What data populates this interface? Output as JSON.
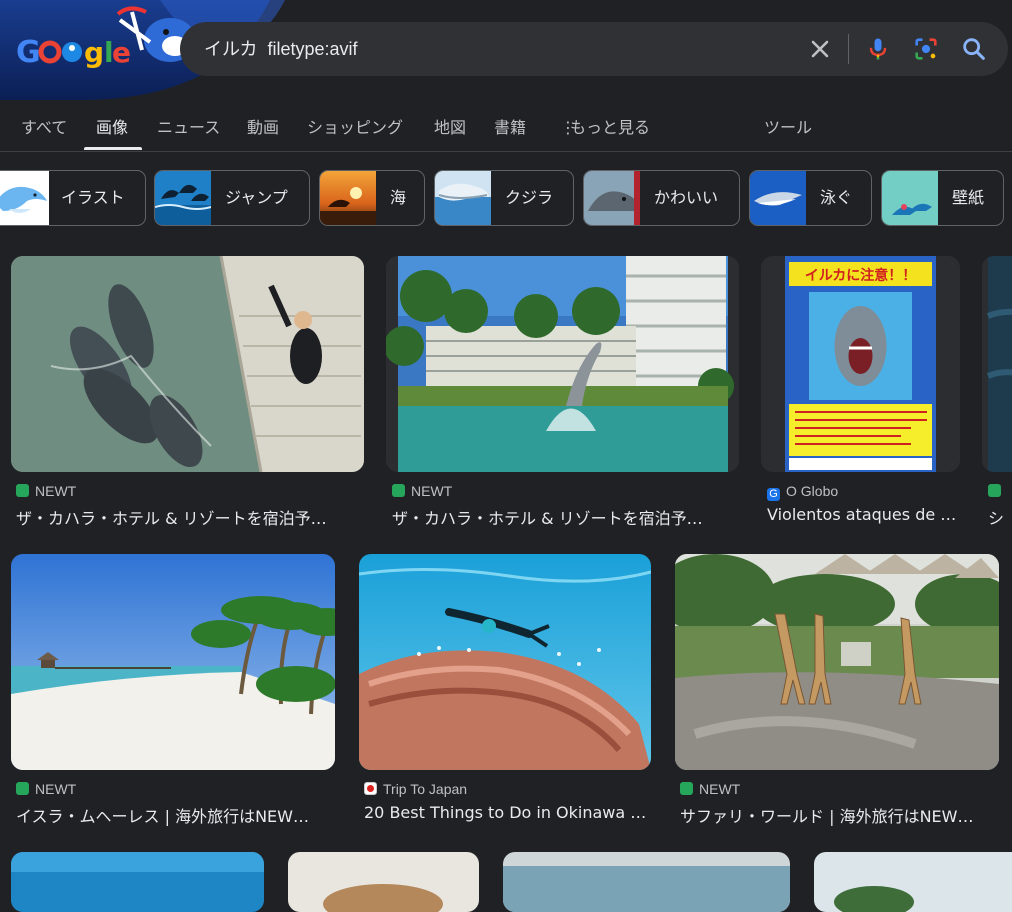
{
  "search": {
    "query": "イルカ  filetype:avif"
  },
  "tabs": [
    {
      "label": "すべて",
      "active": false
    },
    {
      "label": "画像",
      "active": true
    },
    {
      "label": "ニュース",
      "active": false
    },
    {
      "label": "動画",
      "active": false
    },
    {
      "label": "ショッピング",
      "active": false
    },
    {
      "label": "地図",
      "active": false
    },
    {
      "label": "書籍",
      "active": false
    },
    {
      "label": "もっと見る",
      "active": false
    },
    {
      "label": "ツール",
      "active": false
    }
  ],
  "chips": [
    {
      "label": "イラスト",
      "thumb": "dolphin-illustration"
    },
    {
      "label": "ジャンプ",
      "thumb": "dolphins-jumping"
    },
    {
      "label": "海",
      "thumb": "sunset-sea"
    },
    {
      "label": "クジラ",
      "thumb": "whale"
    },
    {
      "label": "かわいい",
      "thumb": "cute-dolphin"
    },
    {
      "label": "泳ぐ",
      "thumb": "swimming-dolphin"
    },
    {
      "label": "壁紙",
      "thumb": "wallpaper"
    }
  ],
  "results": [
    {
      "source": "NEWT",
      "title": "ザ・カハラ・ホテル & リゾートを宿泊予…",
      "favicon": "newt",
      "image": "dolphins-pool"
    },
    {
      "source": "NEWT",
      "title": "ザ・カハラ・ホテル & リゾートを宿泊予…",
      "favicon": "newt",
      "image": "dolphin-resort"
    },
    {
      "source": "O Globo",
      "title": "Violentos ataques de …",
      "favicon": "globo",
      "image": "dolphin-warning-poster"
    },
    {
      "source": "NEWT",
      "title": "シ",
      "favicon": "newt",
      "image": "dark-sea"
    },
    {
      "source": "NEWT",
      "title": "イスラ・ムヘーレス | 海外旅行はNEW…",
      "favicon": "newt",
      "image": "beach-palms"
    },
    {
      "source": "Trip To Japan",
      "title": "20 Best Things to Do in Okinawa I…",
      "favicon": "triptojapan",
      "image": "coral-diver"
    },
    {
      "source": "NEWT",
      "title": "サファリ・ワールド | 海外旅行はNEW…",
      "favicon": "newt",
      "image": "giraffes"
    }
  ],
  "poster": {
    "heading": "イルカに注意！！"
  },
  "colors": {
    "background": "#202124",
    "searchbox": "#303134",
    "text": "#e8eaed",
    "muted": "#bdc1c6",
    "newt_green": "#26a65b"
  }
}
